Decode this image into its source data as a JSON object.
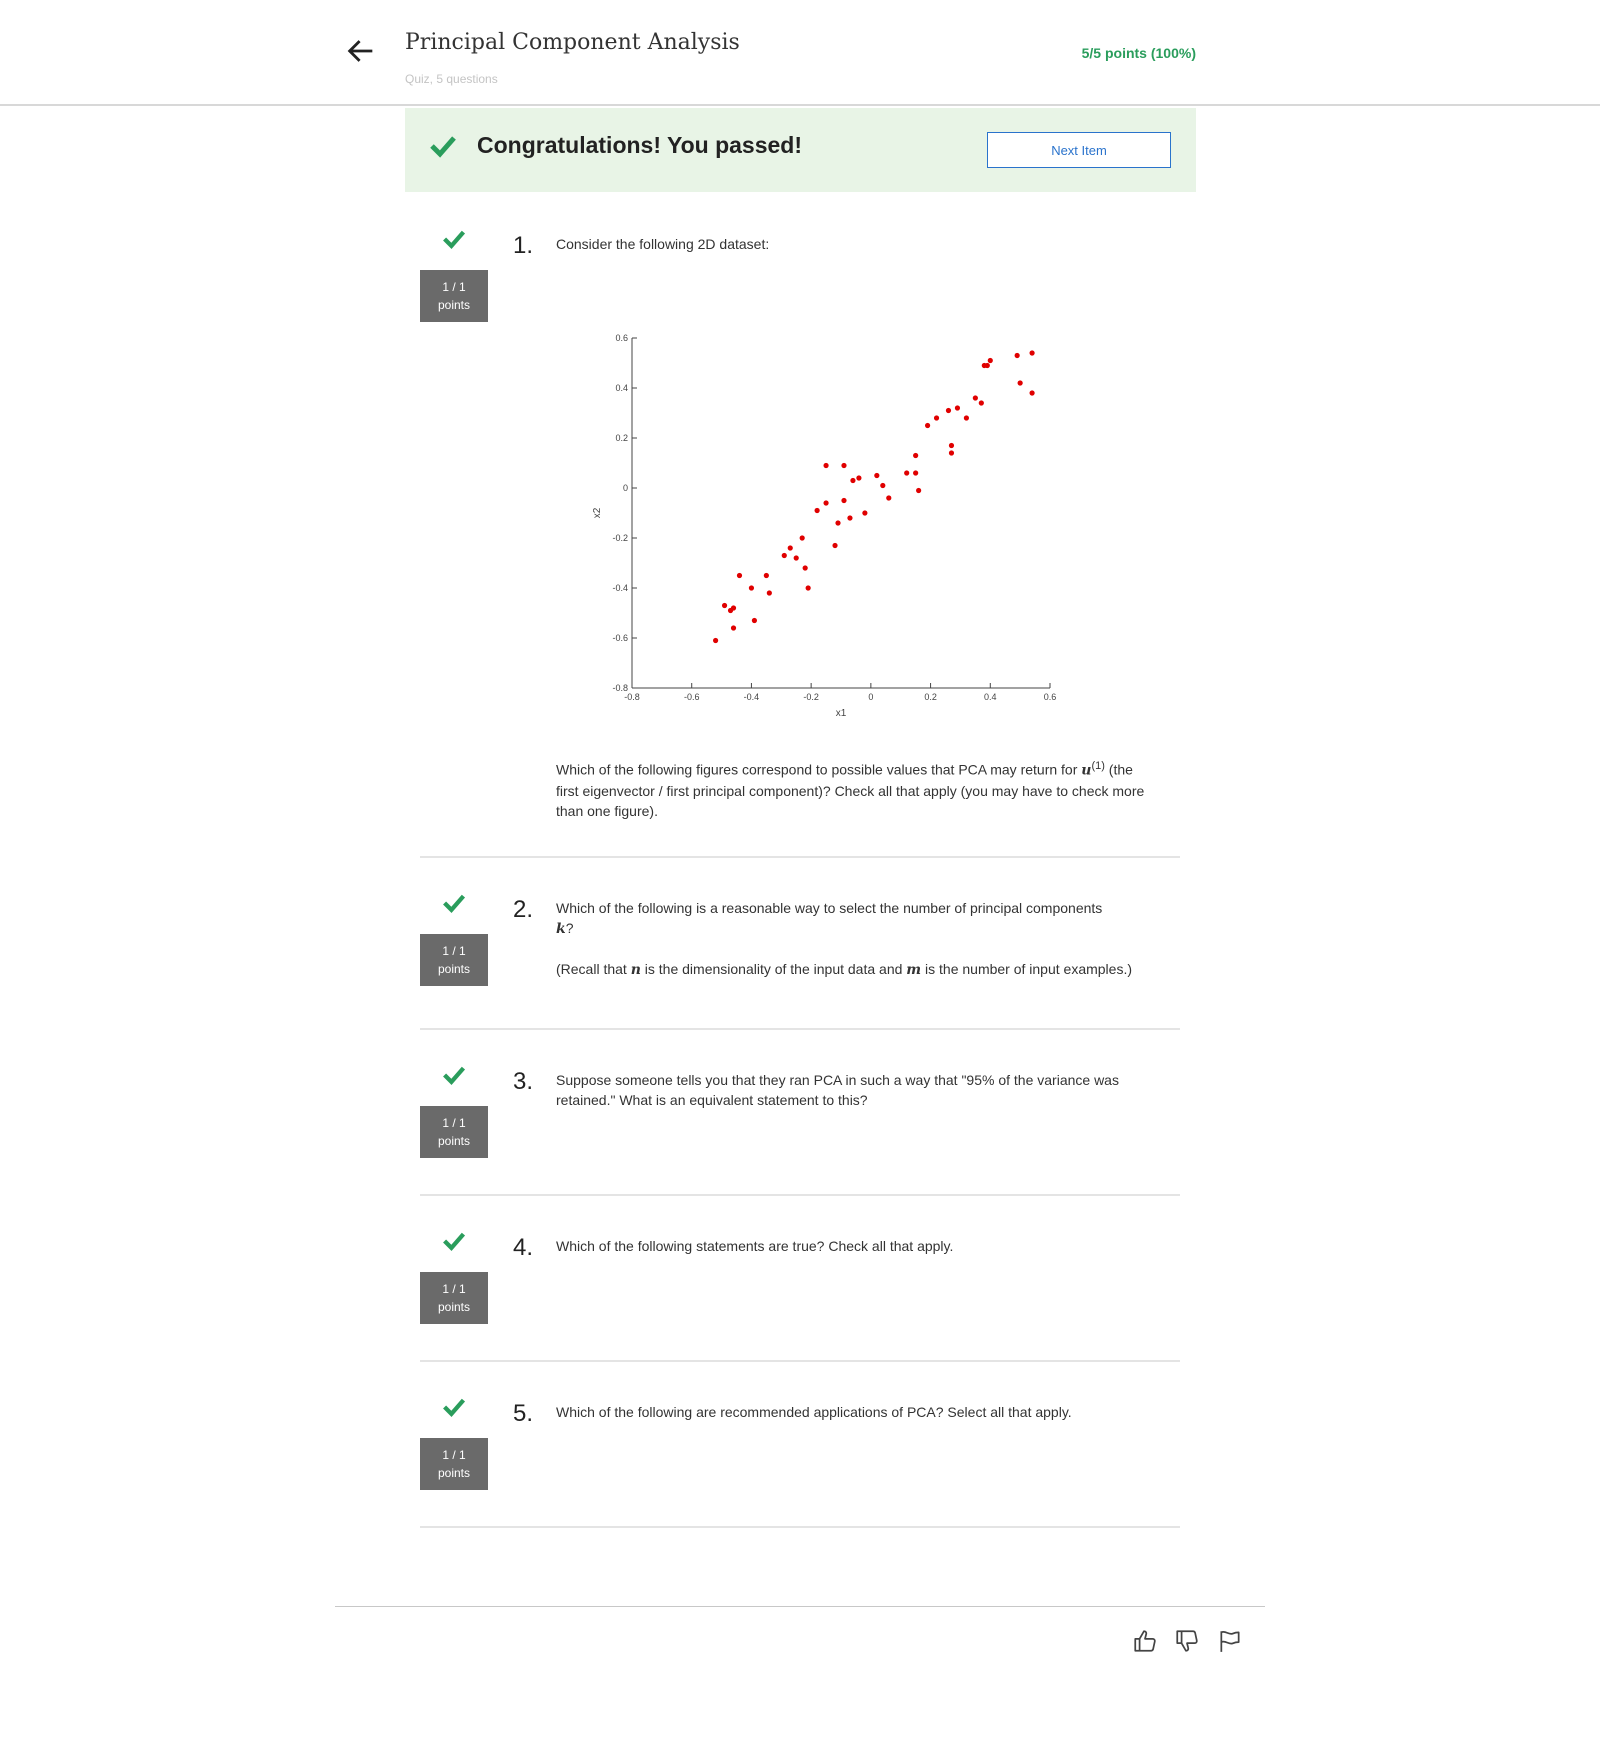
{
  "header": {
    "title": "Principal Component Analysis",
    "subtitle": "Quiz, 5 questions",
    "score": "5/5 points (100%)"
  },
  "banner": {
    "message": "Congratulations! You passed!",
    "next_label": "Next Item"
  },
  "questions": [
    {
      "number": "1.",
      "points": "1 / 1",
      "points_unit": "points",
      "intro": "Consider the following 2D dataset:",
      "body_pre": "Which of the following figures correspond to possible values that PCA may return for ",
      "math_var": "u",
      "math_sup": "(1)",
      "body_post": " (the first eigenvector / first principal component)? Check all that apply (you may have to check more than one figure)."
    },
    {
      "number": "2.",
      "points": "1 / 1",
      "points_unit": "points",
      "text": "Which of the following is a reasonable way to select the number of principal components",
      "math_k": "k",
      "q_mark": "?",
      "recall_pre": "(Recall that ",
      "math_n": "n",
      "recall_mid": " is the dimensionality of the input data and ",
      "math_m": "m",
      "recall_post": " is the number of input examples.)"
    },
    {
      "number": "3.",
      "points": "1 / 1",
      "points_unit": "points",
      "text": "Suppose someone tells you that they ran PCA in such a way that \"95% of the variance was retained.\" What is an equivalent statement to this?"
    },
    {
      "number": "4.",
      "points": "1 / 1",
      "points_unit": "points",
      "text": "Which of the following statements are true? Check all that apply."
    },
    {
      "number": "5.",
      "points": "1 / 1",
      "points_unit": "points",
      "text": "Which of the following are recommended applications of PCA? Select all that apply."
    }
  ],
  "colors": {
    "accent_green": "#2a9d5c",
    "link_blue": "#2a73cc",
    "point_red": "#e00000"
  },
  "icons": [
    "back-arrow-icon",
    "check-icon",
    "thumbs-up-icon",
    "thumbs-down-icon",
    "flag-icon"
  ],
  "chart_data": {
    "type": "scatter",
    "xlabel": "x1",
    "ylabel": "x2",
    "xlim": [
      -0.8,
      0.6
    ],
    "ylim": [
      -0.8,
      0.6
    ],
    "xticks": [
      "-0.8",
      "-0.6",
      "-0.4",
      "-0.2",
      "0",
      "0.2",
      "0.4",
      "0.6"
    ],
    "yticks": [
      "0.6",
      "0.4",
      "0.2",
      "0",
      "-0.2",
      "-0.4",
      "-0.6",
      "-0.8"
    ],
    "grid": false,
    "points": [
      [
        -0.52,
        -0.61
      ],
      [
        -0.49,
        -0.47
      ],
      [
        -0.47,
        -0.49
      ],
      [
        -0.46,
        -0.56
      ],
      [
        -0.46,
        -0.48
      ],
      [
        -0.44,
        -0.35
      ],
      [
        -0.4,
        -0.4
      ],
      [
        -0.39,
        -0.53
      ],
      [
        -0.35,
        -0.35
      ],
      [
        -0.34,
        -0.42
      ],
      [
        -0.29,
        -0.27
      ],
      [
        -0.27,
        -0.24
      ],
      [
        -0.25,
        -0.28
      ],
      [
        -0.23,
        -0.2
      ],
      [
        -0.22,
        -0.32
      ],
      [
        -0.21,
        -0.4
      ],
      [
        -0.18,
        -0.09
      ],
      [
        -0.15,
        -0.06
      ],
      [
        -0.15,
        0.09
      ],
      [
        -0.12,
        -0.23
      ],
      [
        -0.11,
        -0.14
      ],
      [
        -0.09,
        0.09
      ],
      [
        -0.09,
        -0.05
      ],
      [
        -0.07,
        -0.12
      ],
      [
        -0.06,
        0.03
      ],
      [
        -0.04,
        0.04
      ],
      [
        -0.02,
        -0.1
      ],
      [
        0.02,
        0.05
      ],
      [
        0.04,
        0.01
      ],
      [
        0.06,
        -0.04
      ],
      [
        0.12,
        0.06
      ],
      [
        0.15,
        0.13
      ],
      [
        0.15,
        0.06
      ],
      [
        0.16,
        -0.01
      ],
      [
        0.19,
        0.25
      ],
      [
        0.22,
        0.28
      ],
      [
        0.26,
        0.31
      ],
      [
        0.27,
        0.17
      ],
      [
        0.27,
        0.14
      ],
      [
        0.29,
        0.32
      ],
      [
        0.32,
        0.28
      ],
      [
        0.35,
        0.36
      ],
      [
        0.37,
        0.34
      ],
      [
        0.38,
        0.49
      ],
      [
        0.39,
        0.49
      ],
      [
        0.4,
        0.51
      ],
      [
        0.49,
        0.53
      ],
      [
        0.5,
        0.42
      ],
      [
        0.54,
        0.54
      ],
      [
        0.54,
        0.38
      ]
    ]
  }
}
